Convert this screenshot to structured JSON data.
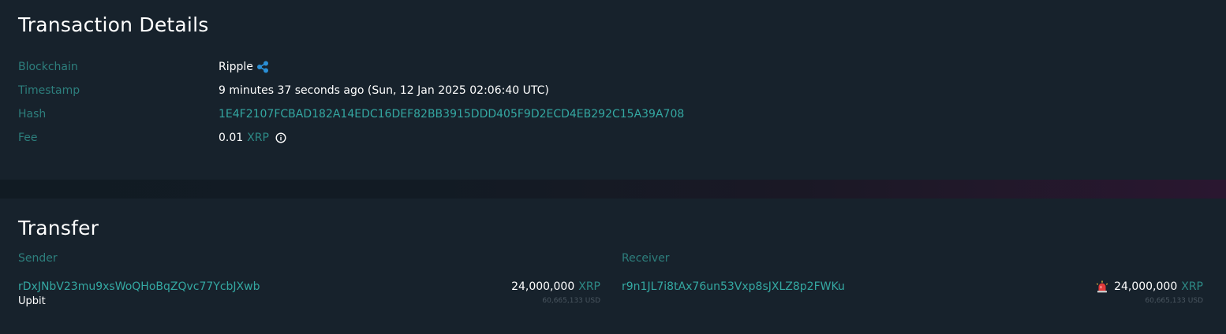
{
  "details": {
    "title": "Transaction Details",
    "rows": [
      {
        "label": "Blockchain",
        "value": "Ripple",
        "icon": "ripple-icon"
      },
      {
        "label": "Timestamp",
        "value": "9 minutes 37 seconds ago (Sun, 12 Jan 2025 02:06:40 UTC)"
      },
      {
        "label": "Hash",
        "value": "1E4F2107FCBAD182A14EDC16DEF82BB3915DDD405F9D2ECD4EB292C15A39A708"
      },
      {
        "label": "Fee",
        "value": "0.01",
        "unit": "XRP",
        "icon": "info-icon"
      }
    ]
  },
  "transfer": {
    "title": "Transfer",
    "sender": {
      "label": "Sender",
      "address": "rDxJNbV23mu9xsWoQHoBqZQvc77YcbJXwb",
      "entity": "Upbit",
      "amount": "24,000,000",
      "unit": "XRP",
      "usd": "60,665,133 USD"
    },
    "receiver": {
      "label": "Receiver",
      "address": "r9n1JL7i8tAx76un53Vxp8sJXLZ8p2FWKu",
      "amount": "24,000,000",
      "unit": "XRP",
      "usd": "60,665,133 USD",
      "icon": "alarm-icon"
    }
  },
  "colors": {
    "background": "#17222c",
    "label": "#2d7f7d",
    "link": "#34a8a2",
    "text": "#ffffff"
  }
}
